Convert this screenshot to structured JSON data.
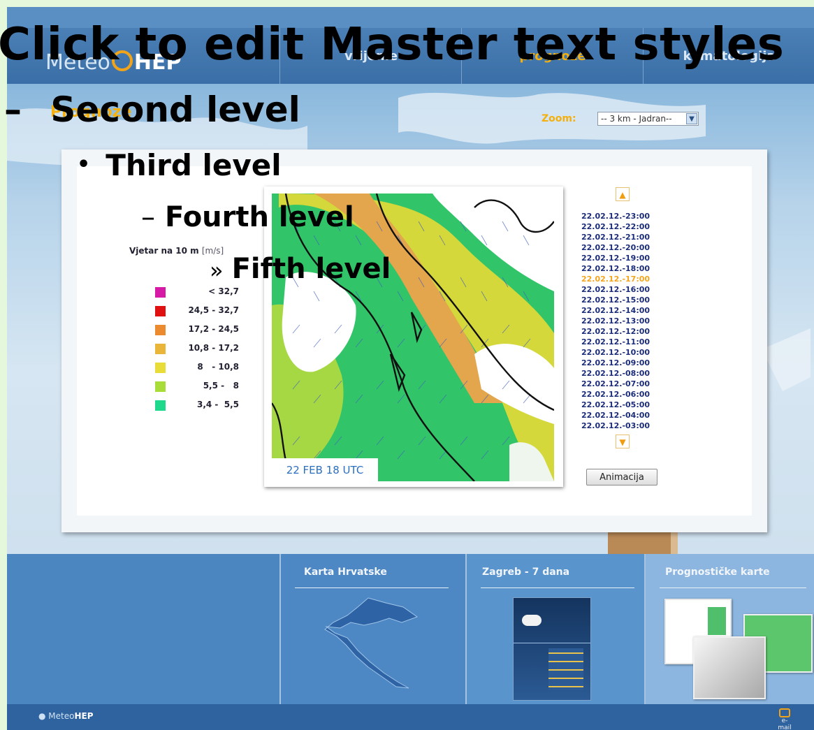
{
  "nav": {
    "logo_prefix": "Meteo",
    "logo_brand": "HEP",
    "tabs": [
      {
        "label": "vrijeme"
      },
      {
        "label": "prognoze"
      },
      {
        "label": "klimatologija"
      }
    ]
  },
  "page": {
    "title": "Prognoze"
  },
  "zoom": {
    "label": "Zoom:",
    "selected": "-- 3 km - Jadran--"
  },
  "legend": {
    "title": "Vjetar na 10 m",
    "unit": "[m/s]",
    "items": [
      {
        "label": "< 32,7",
        "color": "#d61aa6"
      },
      {
        "label": "24,5 - 32,7",
        "color": "#e01010"
      },
      {
        "label": "17,2 - 24,5",
        "color": "#ec8a30"
      },
      {
        "label": "10,8 - 17,2",
        "color": "#eab63a"
      },
      {
        "label": "8   - 10,8",
        "color": "#e8dc38"
      },
      {
        "label": "5,5 -   8",
        "color": "#a8dc38"
      },
      {
        "label": "3,4 -  5,5",
        "color": "#1ed88c"
      }
    ]
  },
  "map": {
    "label": "22 FEB 18 UTC"
  },
  "times": {
    "active_index": 6,
    "items": [
      "22.02.12.-23:00",
      "22.02.12.-22:00",
      "22.02.12.-21:00",
      "22.02.12.-20:00",
      "22.02.12.-19:00",
      "22.02.12.-18:00",
      "22.02.12.-17:00",
      "22.02.12.-16:00",
      "22.02.12.-15:00",
      "22.02.12.-14:00",
      "22.02.12.-13:00",
      "22.02.12.-12:00",
      "22.02.12.-11:00",
      "22.02.12.-10:00",
      "22.02.12.-09:00",
      "22.02.12.-08:00",
      "22.02.12.-07:00",
      "22.02.12.-06:00",
      "22.02.12.-05:00",
      "22.02.12.-04:00",
      "22.02.12.-03:00"
    ]
  },
  "animate_label": "Animacija",
  "bottom": {
    "karta": "Karta Hrvatske",
    "zagreb": "Zagreb - 7 dana",
    "prognosticke": "Prognostičke karte"
  },
  "footer": {
    "logo_prefix": "Meteo",
    "logo_brand": "HEP",
    "email_label": "e-mail"
  },
  "placeholder": {
    "title": "Click to edit Master text styles",
    "level2": "Second level",
    "level3": "Third level",
    "level4": "Fourth level",
    "level5": "Fifth level"
  },
  "colors": {
    "accent": "#f3a51e",
    "nav_bg": "#3a6ea6",
    "time_text": "#1c2d7a"
  }
}
